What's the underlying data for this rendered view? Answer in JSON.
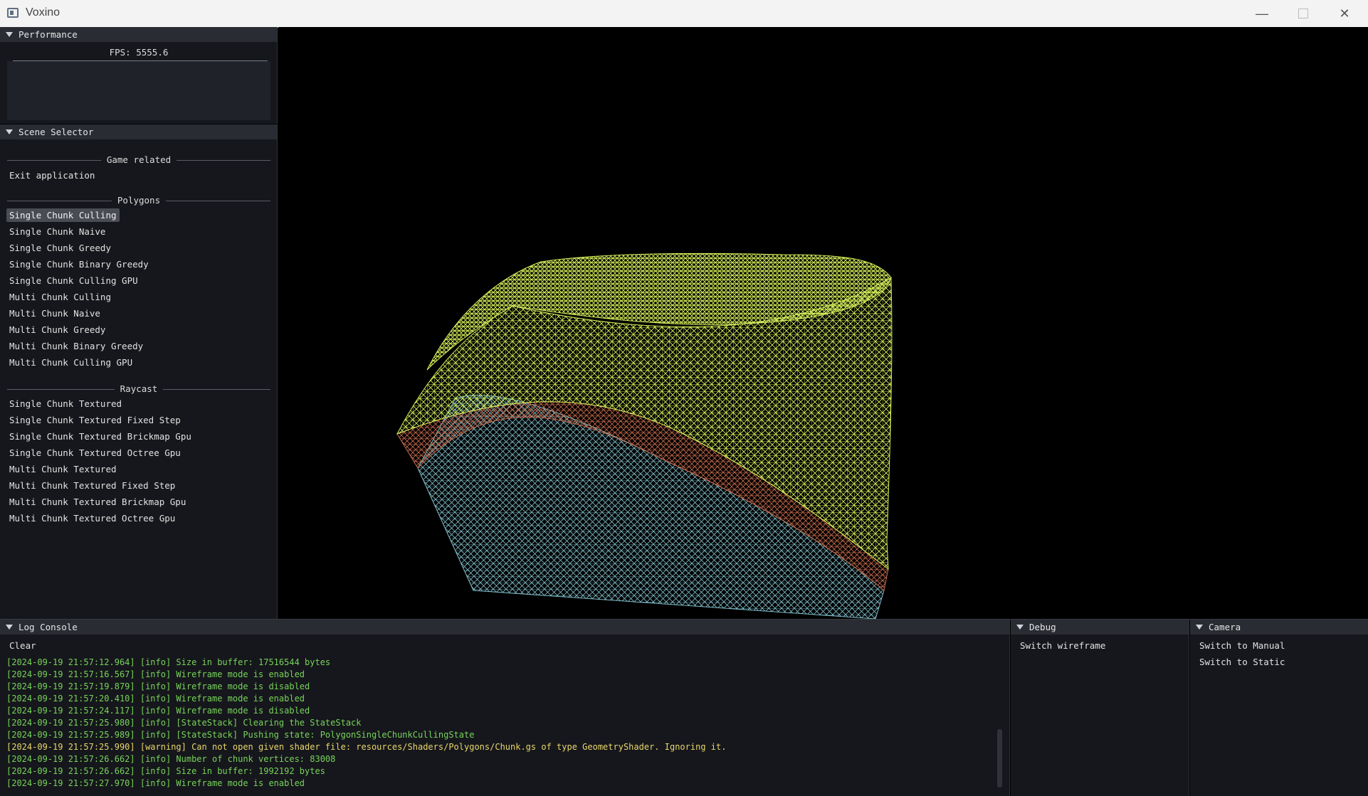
{
  "window": {
    "title": "Voxino"
  },
  "performance": {
    "header": "Performance",
    "fps_label": "FPS: 5555.6"
  },
  "scene_selector": {
    "header": "Scene Selector",
    "groups": [
      {
        "title": "Game related",
        "items": [
          "Exit application"
        ]
      },
      {
        "title": "Polygons",
        "items": [
          "Single Chunk Culling",
          "Single Chunk Naive",
          "Single Chunk Greedy",
          "Single Chunk Binary Greedy",
          "Single Chunk Culling GPU",
          "Multi Chunk Culling",
          "Multi Chunk Naive",
          "Multi Chunk Greedy",
          "Multi Chunk Binary Greedy",
          "Multi Chunk Culling GPU"
        ]
      },
      {
        "title": "Raycast",
        "items": [
          "Single Chunk Textured",
          "Single Chunk Textured Fixed Step",
          "Single Chunk Textured Brickmap Gpu",
          "Single Chunk Textured Octree Gpu",
          "Multi Chunk Textured",
          "Multi Chunk Textured Fixed Step",
          "Multi Chunk Textured Brickmap Gpu",
          "Multi Chunk Textured Octree Gpu"
        ]
      }
    ],
    "selected_item": "Single Chunk Culling"
  },
  "log_console": {
    "header": "Log Console",
    "clear_label": "Clear",
    "lines": [
      {
        "level": "info",
        "text": "[2024-09-19 21:57:12.964] [info] Size in buffer: 17516544 bytes"
      },
      {
        "level": "info",
        "text": "[2024-09-19 21:57:16.567] [info] Wireframe mode is enabled"
      },
      {
        "level": "info",
        "text": "[2024-09-19 21:57:19.879] [info] Wireframe mode is disabled"
      },
      {
        "level": "info",
        "text": "[2024-09-19 21:57:20.410] [info] Wireframe mode is enabled"
      },
      {
        "level": "info",
        "text": "[2024-09-19 21:57:24.117] [info] Wireframe mode is disabled"
      },
      {
        "level": "info",
        "text": "[2024-09-19 21:57:25.980] [info] [StateStack] Clearing the StateStack"
      },
      {
        "level": "info",
        "text": "[2024-09-19 21:57:25.989] [info] [StateStack] Pushing state: PolygonSingleChunkCullingState"
      },
      {
        "level": "warning",
        "text": "[2024-09-19 21:57:25.990] [warning] Can not open given shader file: resources/Shaders/Polygons/Chunk.gs of type GeometryShader. Ignoring it."
      },
      {
        "level": "info",
        "text": "[2024-09-19 21:57:26.662] [info] Number of chunk vertices: 83008"
      },
      {
        "level": "info",
        "text": "[2024-09-19 21:57:26.662] [info] Size in buffer: 1992192 bytes"
      },
      {
        "level": "info",
        "text": "[2024-09-19 21:57:27.970] [info] Wireframe mode is enabled"
      }
    ]
  },
  "debug": {
    "header": "Debug",
    "switch_wireframe_label": "Switch wireframe"
  },
  "camera": {
    "header": "Camera",
    "switch_manual_label": "Switch to Manual",
    "switch_static_label": "Switch to Static"
  },
  "colors": {
    "grass": "#d6f05a",
    "dirt": "#c0674a",
    "stone": "#7fbecb",
    "info": "#77d35a",
    "warning": "#e8d66b"
  }
}
